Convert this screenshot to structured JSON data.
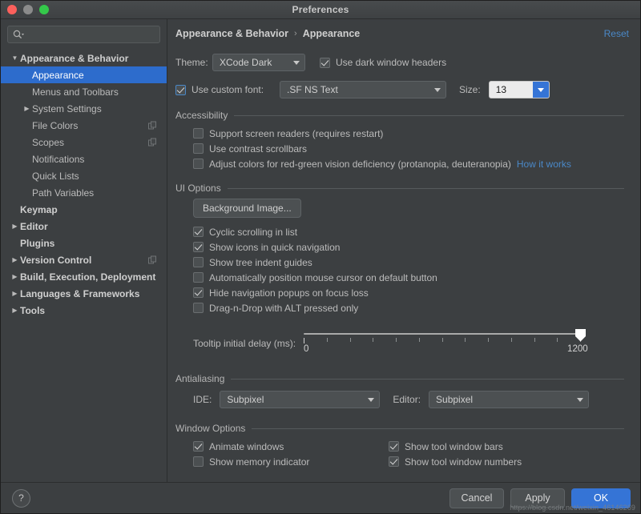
{
  "window": {
    "title": "Preferences",
    "traffic_lights": [
      "close",
      "minimize",
      "zoom"
    ]
  },
  "sidebar": {
    "search": {
      "value": "",
      "placeholder": ""
    },
    "items": [
      {
        "label": "Appearance & Behavior",
        "indent": 0,
        "arrow": "down",
        "bold": true,
        "selected": false,
        "copy_icon": false
      },
      {
        "label": "Appearance",
        "indent": 1,
        "arrow": "none",
        "bold": false,
        "selected": true,
        "copy_icon": false
      },
      {
        "label": "Menus and Toolbars",
        "indent": 1,
        "arrow": "none",
        "bold": false,
        "selected": false,
        "copy_icon": false
      },
      {
        "label": "System Settings",
        "indent": 1,
        "arrow": "right",
        "bold": false,
        "selected": false,
        "copy_icon": false
      },
      {
        "label": "File Colors",
        "indent": 1,
        "arrow": "none",
        "bold": false,
        "selected": false,
        "copy_icon": true
      },
      {
        "label": "Scopes",
        "indent": 1,
        "arrow": "none",
        "bold": false,
        "selected": false,
        "copy_icon": true
      },
      {
        "label": "Notifications",
        "indent": 1,
        "arrow": "none",
        "bold": false,
        "selected": false,
        "copy_icon": false
      },
      {
        "label": "Quick Lists",
        "indent": 1,
        "arrow": "none",
        "bold": false,
        "selected": false,
        "copy_icon": false
      },
      {
        "label": "Path Variables",
        "indent": 1,
        "arrow": "none",
        "bold": false,
        "selected": false,
        "copy_icon": false
      },
      {
        "label": "Keymap",
        "indent": 0,
        "arrow": "none",
        "bold": true,
        "selected": false,
        "copy_icon": false
      },
      {
        "label": "Editor",
        "indent": 0,
        "arrow": "right",
        "bold": true,
        "selected": false,
        "copy_icon": false
      },
      {
        "label": "Plugins",
        "indent": 0,
        "arrow": "none",
        "bold": true,
        "selected": false,
        "copy_icon": false
      },
      {
        "label": "Version Control",
        "indent": 0,
        "arrow": "right",
        "bold": true,
        "selected": false,
        "copy_icon": true
      },
      {
        "label": "Build, Execution, Deployment",
        "indent": 0,
        "arrow": "right",
        "bold": true,
        "selected": false,
        "copy_icon": false
      },
      {
        "label": "Languages & Frameworks",
        "indent": 0,
        "arrow": "right",
        "bold": true,
        "selected": false,
        "copy_icon": false
      },
      {
        "label": "Tools",
        "indent": 0,
        "arrow": "right",
        "bold": true,
        "selected": false,
        "copy_icon": false
      }
    ]
  },
  "breadcrumb": {
    "parent": "Appearance & Behavior",
    "separator": "›",
    "current": "Appearance",
    "reset_label": "Reset"
  },
  "theme_row": {
    "label": "Theme:",
    "value": "XCode Dark",
    "dark_headers_label": "Use dark window headers",
    "dark_headers_checked": true
  },
  "font_row": {
    "custom_font_label": "Use custom font:",
    "custom_font_checked": true,
    "font_value": ".SF NS Text",
    "size_label": "Size:",
    "size_value": "13"
  },
  "accessibility": {
    "title": "Accessibility",
    "options": [
      {
        "label": "Support screen readers (requires restart)",
        "checked": false
      },
      {
        "label": "Use contrast scrollbars",
        "checked": false
      },
      {
        "label": "Adjust colors for red-green vision deficiency (protanopia, deuteranopia)",
        "checked": false,
        "link": "How it works"
      }
    ]
  },
  "ui_options": {
    "title": "UI Options",
    "background_image_button": "Background Image...",
    "options": [
      {
        "label": "Cyclic scrolling in list",
        "checked": true
      },
      {
        "label": "Show icons in quick navigation",
        "checked": true
      },
      {
        "label": "Show tree indent guides",
        "checked": false
      },
      {
        "label": "Automatically position mouse cursor on default button",
        "checked": false
      },
      {
        "label": "Hide navigation popups on focus loss",
        "checked": true
      },
      {
        "label": "Drag-n-Drop with ALT pressed only",
        "checked": false
      }
    ],
    "slider": {
      "label": "Tooltip initial delay (ms):",
      "min_label": "0",
      "max_label": "1200",
      "min": 0,
      "max": 1200,
      "value": 1200,
      "tick_count": 13
    }
  },
  "antialiasing": {
    "title": "Antialiasing",
    "ide_label": "IDE:",
    "ide_value": "Subpixel",
    "editor_label": "Editor:",
    "editor_value": "Subpixel"
  },
  "window_options": {
    "title": "Window Options",
    "left": [
      {
        "label": "Animate windows",
        "checked": true
      },
      {
        "label": "Show memory indicator",
        "checked": false
      }
    ],
    "right": [
      {
        "label": "Show tool window bars",
        "checked": true
      },
      {
        "label": "Show tool window numbers",
        "checked": true
      }
    ]
  },
  "bottom_bar": {
    "help_glyph": "?",
    "cancel_label": "Cancel",
    "apply_label": "Apply",
    "ok_label": "OK"
  },
  "watermark": "https://blog.csdn.net/weixin_46146269",
  "colors": {
    "accent_blue": "#3574d6",
    "selection_blue": "#2d6ccc",
    "link_blue": "#4a88c7",
    "panel_bg": "#3c3f41",
    "control_bg": "#4c5052",
    "text": "#bbbbbb"
  }
}
